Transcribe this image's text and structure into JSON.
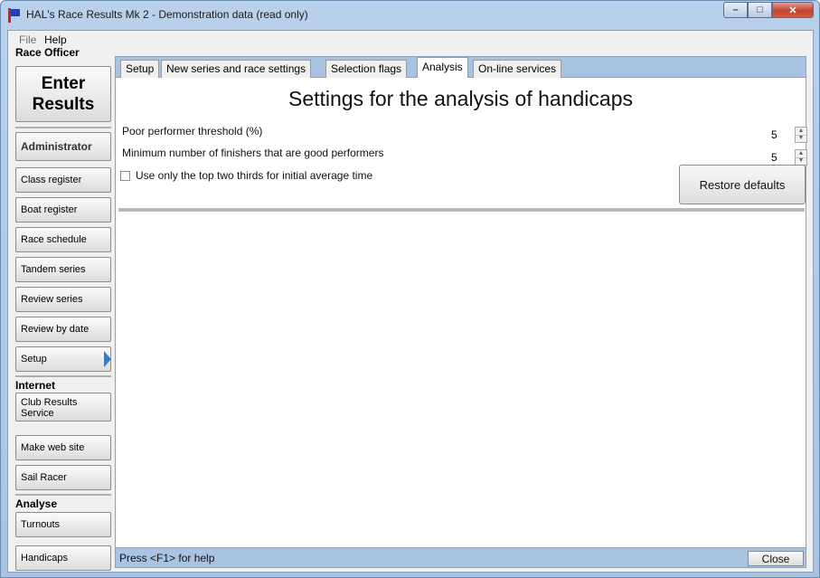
{
  "window": {
    "title": "HAL's Race Results Mk 2 - Demonstration data (read only)"
  },
  "menu": {
    "file": "File",
    "help": "Help"
  },
  "sidebar": {
    "race_officer_label": "Race Officer",
    "enter_results_line1": "Enter",
    "enter_results_line2": "Results",
    "administrator": "Administrator",
    "admin_items": [
      "Class register",
      "Boat register",
      "Race schedule",
      "Tandem series",
      "Review series",
      "Review by date",
      "Setup"
    ],
    "internet_label": "Internet",
    "internet_items": [
      "Club Results Service",
      "Make web site",
      "Sail Racer"
    ],
    "analyse_label": "Analyse",
    "analyse_items": [
      "Turnouts",
      "Handicaps"
    ]
  },
  "tabs": [
    "Setup",
    "New series and race settings",
    "Selection flags",
    "Analysis",
    "On-line services"
  ],
  "active_tab": "Analysis",
  "analysis": {
    "heading": "Settings for the analysis of handicaps",
    "poor_performer_label": "Poor performer threshold (%)",
    "poor_performer_value": "5",
    "min_finishers_label": "Minimum number of finishers that are good performers",
    "min_finishers_value": "5",
    "top_two_thirds_label": "Use only the top two thirds for initial average time",
    "top_two_thirds_checked": false,
    "restore_defaults": "Restore defaults"
  },
  "status": {
    "help_text": "Press <F1> for help",
    "close": "Close"
  },
  "colors": {
    "titlebar": "#b9d1ea",
    "tab_strip": "#a9c3e2",
    "setup_arrow": "#2e7fd0",
    "close_button": "#c2442f"
  },
  "icons": {
    "app": "race-flag-icon",
    "minimize": "minimize-icon",
    "maximize": "maximize-icon",
    "close": "close-icon",
    "spin_up": "spin-up-icon",
    "spin_down": "spin-down-icon",
    "selected": "selected-arrow-icon"
  }
}
